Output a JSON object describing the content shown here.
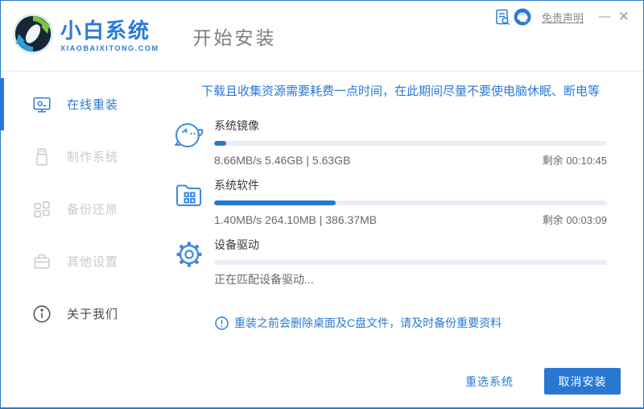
{
  "header": {
    "brand_name": "小白系统",
    "brand_domain": "XIAOBAIXITONG.COM",
    "page_title": "开始安装",
    "disclaimer_link": "免责声明",
    "minimize_glyph": "—",
    "close_glyph": "✕"
  },
  "sidebar": {
    "items": [
      {
        "label": "在线重装",
        "state": "active"
      },
      {
        "label": "制作系统",
        "state": "disabled"
      },
      {
        "label": "备份还原",
        "state": "disabled"
      },
      {
        "label": "其他设置",
        "state": "disabled"
      },
      {
        "label": "关于我们",
        "state": "normal"
      }
    ]
  },
  "main": {
    "top_notice": "下载且收集资源需要耗费一点时间，在此期间尽量不要使电脑休眠、断电等",
    "tasks": [
      {
        "title": "系统镜像",
        "progress_percent": 3,
        "stats": "8.66MB/s 5.46GB | 5.63GB",
        "remaining": "剩余 00:10:45",
        "icon": "mascot-face-icon"
      },
      {
        "title": "系统软件",
        "progress_percent": 31,
        "stats": "1.40MB/s 264.10MB | 386.37MB",
        "remaining": "剩余 00:03:09",
        "icon": "folder-apps-icon"
      },
      {
        "title": "设备驱动",
        "progress_percent": 0,
        "stats": "正在匹配设备驱动...",
        "remaining": "",
        "icon": "gear-icon"
      }
    ],
    "warning_notice": "重装之前会删除桌面及C盘文件，请及时备份重要资料"
  },
  "footer": {
    "reselect_label": "重选系统",
    "cancel_label": "取消安装"
  },
  "colors": {
    "accent_blue": "#2b7ad6",
    "progress_fill": "#2878d2",
    "progress_track": "#e9eef6",
    "window_border": "#2a7ad0",
    "disabled_gray": "#c5cad1",
    "logo_green": "#7dc53e",
    "logo_light_blue": "#2da0e2"
  }
}
